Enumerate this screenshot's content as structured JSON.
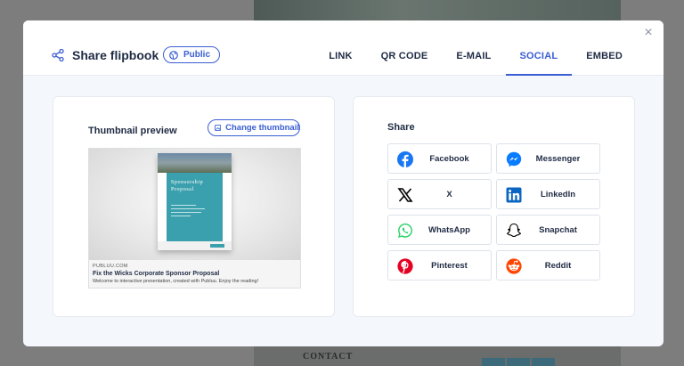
{
  "background": {
    "contact_text": "CONTACT"
  },
  "modal": {
    "title": "Share flipbook",
    "visibility_badge": "Public",
    "close_symbol": "×",
    "tabs": [
      {
        "label": "LINK",
        "active": false
      },
      {
        "label": "QR CODE",
        "active": false
      },
      {
        "label": "E-MAIL",
        "active": false
      },
      {
        "label": "SOCIAL",
        "active": true
      },
      {
        "label": "EMBED",
        "active": false
      }
    ]
  },
  "thumbnail": {
    "title": "Thumbnail preview",
    "change_button": "Change thumbnail",
    "booklet_heading_line1": "Sponsorship",
    "booklet_heading_line2": "Proposal",
    "domain": "PUBLUU.COM",
    "preview_title": "Fix the Wicks Corporate Sponsor Proposal",
    "preview_description": "Welcome to interactive presentation, created with Publuu. Enjoy the reading!"
  },
  "share": {
    "title": "Share",
    "networks": [
      {
        "label": "Facebook",
        "icon": "facebook-icon",
        "color": "#1877f2"
      },
      {
        "label": "Messenger",
        "icon": "messenger-icon",
        "color": "#0a7cff"
      },
      {
        "label": "X",
        "icon": "x-icon",
        "color": "#000000"
      },
      {
        "label": "LinkedIn",
        "icon": "linkedin-icon",
        "color": "#0a66c2"
      },
      {
        "label": "WhatsApp",
        "icon": "whatsapp-icon",
        "color": "#25d366"
      },
      {
        "label": "Snapchat",
        "icon": "snapchat-icon",
        "color": "#000000"
      },
      {
        "label": "Pinterest",
        "icon": "pinterest-icon",
        "color": "#e60023"
      },
      {
        "label": "Reddit",
        "icon": "reddit-icon",
        "color": "#ff4500"
      }
    ]
  },
  "colors": {
    "accent": "#3a5ed2",
    "text": "#1f2b44",
    "modal_bg": "#f4f7fb"
  }
}
